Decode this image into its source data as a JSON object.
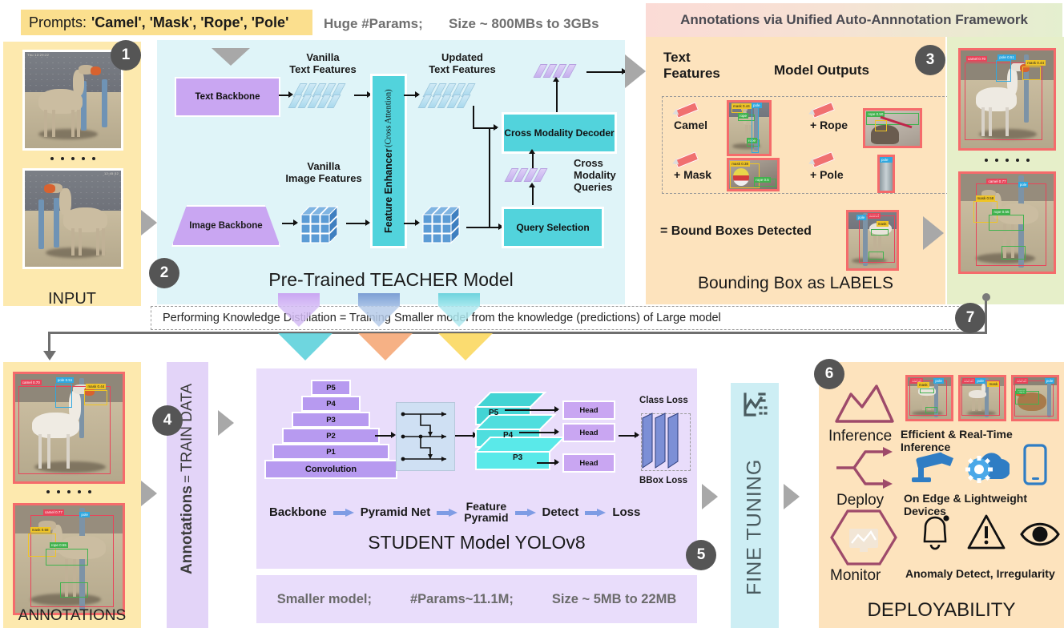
{
  "top": {
    "prompt_prefix": "Prompts:",
    "prompt_values": "'Camel', 'Mask', 'Rope', 'Pole'",
    "note_params": "Huge #Params;",
    "note_size": "Size ~ 800MBs to 3GBs"
  },
  "input_panel": {
    "caption": "INPUT",
    "badge": "1"
  },
  "teacher": {
    "title": "Pre-Trained TEACHER Model",
    "badge": "2",
    "text_backbone": "Text Backbone",
    "image_backbone": "Image Backbone",
    "vanilla_text": "Vanilla\nText Features",
    "vanilla_text_l1": "Vanilla",
    "vanilla_text_l2": "Text Features",
    "vanilla_image_l1": "Vanilla",
    "vanilla_image_l2": "Image Features",
    "updated_text_l1": "Updated",
    "updated_text_l2": "Text Features",
    "feature_enhancer_l1": "Feature Enhancer",
    "feature_enhancer_l2": "(Cross Attention)",
    "cross_modality_decoder": "Cross Modality Decoder",
    "query_selection": "Query Selection",
    "cross_modality_queries_l1": "Cross",
    "cross_modality_queries_l2": "Modality",
    "cross_modality_queries_l3": "Queries"
  },
  "annotation_panel": {
    "header": "Annotations via Unified Auto-Annnotation Framework",
    "badge": "3",
    "col_text_features_l1": "Text",
    "col_text_features_l2": "Features",
    "col_model_outputs": "Model Outputs",
    "rows": [
      {
        "label": "Camel",
        "out_tags": [
          "mask 0.44",
          "rope 0.63",
          "pole 0.51"
        ]
      },
      {
        "label": "+ Rope",
        "out_tags": [
          "rope 0.50"
        ]
      },
      {
        "label": "+ Mask",
        "out_tags": [
          "mask 0.38",
          "rope 0.5"
        ]
      },
      {
        "label": "+ Pole",
        "out_tags": [
          "pole"
        ]
      }
    ],
    "bound_boxes_note": "= Bound Boxes Detected",
    "caption": "Bounding Box as LABELS"
  },
  "kd_banner": {
    "text": "Performing Knowledge Distillation = Training Smaller model from the knowledge (predictions) of Large model",
    "badge": "7"
  },
  "annotations_panel": {
    "caption": "ANNOTATIONS",
    "badge": "4"
  },
  "train_data": {
    "bold": "Annotations",
    "equals": "=",
    "rest": "TRAIN DATA"
  },
  "student": {
    "title": "STUDENT Model YOLOv8",
    "badge": "5",
    "pyramid": [
      "P5",
      "P4",
      "P3",
      "P2",
      "P1",
      "Convolution"
    ],
    "feature_pyramid": [
      "P5",
      "P4",
      "P3"
    ],
    "heads": [
      "Head",
      "Head",
      "Head"
    ],
    "class_loss": "Class Loss",
    "bbox_loss": "BBox Loss",
    "flow": [
      "Backbone",
      "Pyramid Net",
      "Feature\nPyramid",
      "Detect",
      "Loss"
    ],
    "flow_feature_l1": "Feature",
    "flow_feature_l2": "Pyramid",
    "footer_smaller": "Smaller model;",
    "footer_params": "#Params~11.1M;",
    "footer_size": "Size ~ 5MB to 22MB"
  },
  "fine_tuning": {
    "label": "FINE TUNING"
  },
  "deploy": {
    "badge": "6",
    "caption": "DEPLOYABILITY",
    "rows": [
      {
        "icon_label": "Inference",
        "icon": "mountain-icon",
        "desc": "Efficient & Real-Time Inference"
      },
      {
        "icon_label": "Deploy",
        "icon": "branch-arrow-icon",
        "desc": "On Edge & Lightweight Devices"
      },
      {
        "icon_label": "Monitor",
        "icon": "hexagon-monitor-icon",
        "desc": "Anomaly Detect, Irregularity"
      }
    ],
    "device_icons": [
      "cctv-camera-icon",
      "cloud-gear-icon",
      "smartphone-icon"
    ],
    "monitor_icons": [
      "bell-icon",
      "warning-triangle-icon",
      "eye-icon"
    ]
  },
  "colors": {
    "input_bg": "#fde9ae",
    "teacher_bg": "#dff4f8",
    "annotation_bg": "#fde3bd",
    "right_images_bg": "#e6efc9",
    "student_bg": "#e9ddfb",
    "finetune_bg": "#cdeef4",
    "purple_box": "#c9a6f2",
    "teal_box": "#52d3dc",
    "badge": "#555555",
    "chevron": "#a8a8a8",
    "prompt_bar": "#fbdf8e",
    "bbox_red": "#e8445a",
    "bbox_blue": "#2fa8e0",
    "bbox_yellow": "#efc426",
    "bbox_green": "#41b24e"
  }
}
